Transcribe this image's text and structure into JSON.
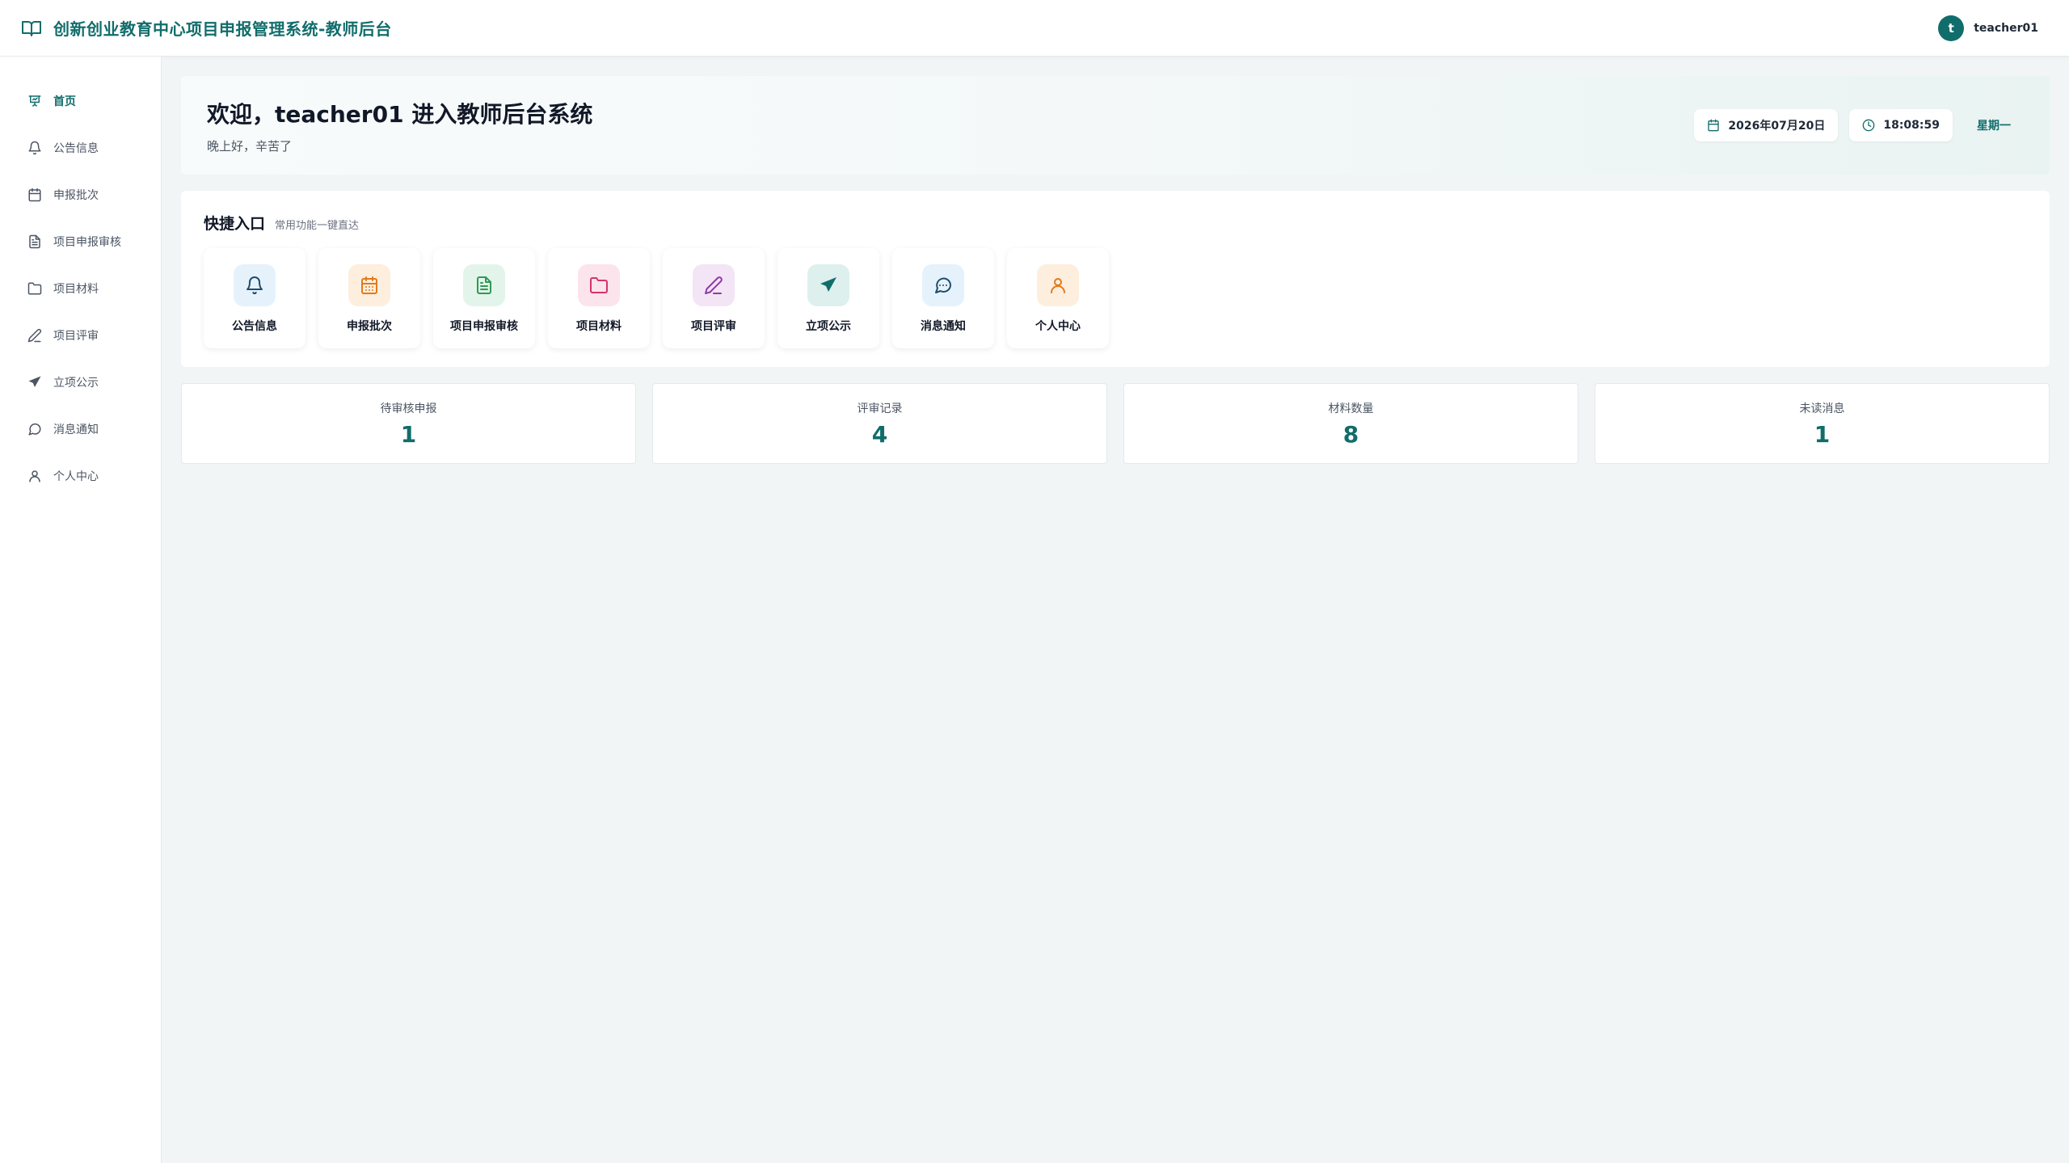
{
  "header": {
    "title": "创新创业教育中心项目申报管理系统-教师后台",
    "brand_icon": "book-open-icon",
    "user": {
      "avatar_letter": "t",
      "name": "teacher01"
    }
  },
  "sidebar": {
    "items": [
      {
        "label": "首页",
        "icon": "presentation-icon",
        "active": true
      },
      {
        "label": "公告信息",
        "icon": "bell-icon"
      },
      {
        "label": "申报批次",
        "icon": "calendar-icon"
      },
      {
        "label": "项目申报审核",
        "icon": "document-icon"
      },
      {
        "label": "项目材料",
        "icon": "folder-icon"
      },
      {
        "label": "项目评审",
        "icon": "pen-icon"
      },
      {
        "label": "立项公示",
        "icon": "send-icon"
      },
      {
        "label": "消息通知",
        "icon": "message-icon"
      },
      {
        "label": "个人中心",
        "icon": "user-icon"
      }
    ]
  },
  "welcome": {
    "title": "欢迎，teacher01 进入教师后台系统",
    "subtitle": "晚上好，辛苦了",
    "date": "2026年07月20日",
    "time": "18:08:59",
    "weekday": "星期一"
  },
  "quick": {
    "title": "快捷入口",
    "subtitle": "常用功能一键直达",
    "tiles": [
      {
        "label": "公告信息",
        "icon": "bell-icon",
        "bg": "#e6f2fb",
        "fg": "#1e4e6e"
      },
      {
        "label": "申报批次",
        "icon": "calendar-icon",
        "bg": "#fdeede",
        "fg": "#e27a1a"
      },
      {
        "label": "项目申报审核",
        "icon": "document-icon",
        "bg": "#e3f5ea",
        "fg": "#2f9a55"
      },
      {
        "label": "项目材料",
        "icon": "folder-icon",
        "bg": "#fce4ec",
        "fg": "#d6336c"
      },
      {
        "label": "项目评审",
        "icon": "pen-icon",
        "bg": "#f3e5f5",
        "fg": "#8e3aa8"
      },
      {
        "label": "立项公示",
        "icon": "send-icon",
        "bg": "#ddf0ee",
        "fg": "#116d6b"
      },
      {
        "label": "消息通知",
        "icon": "message-icon",
        "bg": "#e6f2fb",
        "fg": "#1e4e6e"
      },
      {
        "label": "个人中心",
        "icon": "user-icon",
        "bg": "#fdeede",
        "fg": "#e27a1a"
      }
    ]
  },
  "stats": [
    {
      "label": "待审核申报",
      "value": "1"
    },
    {
      "label": "评审记录",
      "value": "4"
    },
    {
      "label": "材料数量",
      "value": "8"
    },
    {
      "label": "未读消息",
      "value": "1"
    }
  ],
  "colors": {
    "primary": "#116d6b",
    "background": "#f1f5f6"
  }
}
